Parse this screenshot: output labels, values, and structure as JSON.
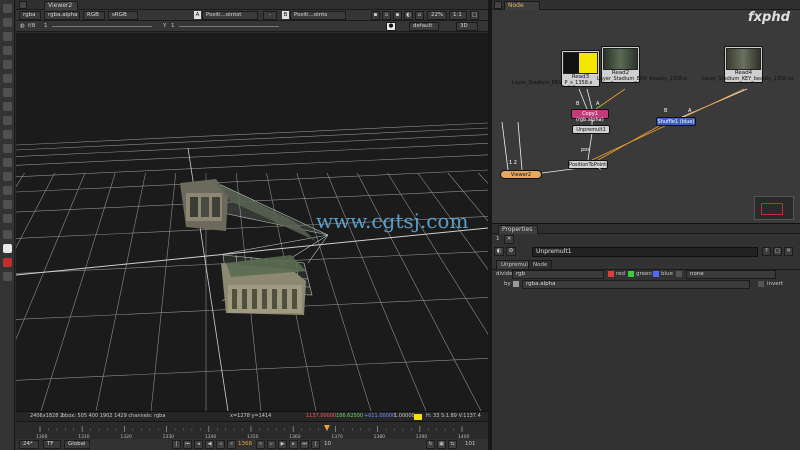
{
  "viewer": {
    "tab_label": "Viewer2",
    "channels": "rgba",
    "alpha_channel": "rgba.alpha",
    "colorspace_mode": "RGB",
    "lut": "sRGB",
    "input_a_letter": "A",
    "input_a": "Positi...ointst",
    "input_b_letter": "B",
    "input_b": "Positi...oints",
    "zoom": "22%",
    "proxy_ratio": "1:1",
    "gain_label": "f/8",
    "gain_value": "1",
    "x_label": "Y",
    "x_value": "1",
    "view": "default",
    "mode_3d": "3D",
    "watermark": "www.cgtsj.com",
    "info_format": "2406x1828 2",
    "info_bbox": "bbox: 505 400 1902 1429 channels: rgba",
    "info_coords": "x=1278 y=1414",
    "info_r": "1137.00000",
    "info_g": "186.62500",
    "info_b": "+011.00000",
    "info_a": "1.00000",
    "info_hsv": "H: 33 S:1.89 V:1137.4"
  },
  "timeline": {
    "start": "1300",
    "ticks": [
      "1300",
      "1310",
      "1320",
      "1330",
      "1340",
      "1350",
      "1360",
      "1370",
      "1380",
      "1390",
      "1400"
    ],
    "end": "1400",
    "current_frame": 1368,
    "fps": "24*",
    "time_format": "TF",
    "range_mode": "Global",
    "frame_display": "1368",
    "skip_value": "10",
    "end_display": "101"
  },
  "node_graph": {
    "tab_label": "Node Graph",
    "logo": "fxphd",
    "nodes": {
      "read3": "Read3",
      "read3_sub": "Layer_Stadium_ENV_P_s_1358.exr",
      "read2": "Read2",
      "read2_sub": "Layer_Stadium_ENV_beauty_1358.exr",
      "read4": "Read4",
      "read4_sub": "Layer_Stadium_KEY_beauty_1358.exr",
      "copy1": "Copy1",
      "copy1_sub": "(rgb.alpha)",
      "unpremult1": "Unpremult1",
      "shuffle1": "Shuffle1 (blue)",
      "position_to_points": "PositionToPoints",
      "viewer2": "Viewer2",
      "viewer_inputs": "1 2",
      "input_b": "B",
      "input_a": "A",
      "input_pos": "pos"
    }
  },
  "properties": {
    "tab_label": "Properties",
    "node_name": "Unpremult1",
    "sub_tabs": [
      "Unpremult",
      "Node"
    ],
    "divide_label": "divide",
    "divide_value": "rgb",
    "red": "red",
    "green": "green",
    "blue": "blue",
    "none_value": "none",
    "by_label": "by",
    "by_value": "rgba.alpha",
    "invert_label": "invert",
    "count": "1"
  },
  "colors": {
    "accent": "#e8a23a",
    "read_node": "#d0d0d0",
    "copy_node": "#c23b7a",
    "shuffle_node": "#3b5fc0",
    "viewer_node": "#e5a862",
    "grid": "#8e8e8e"
  }
}
